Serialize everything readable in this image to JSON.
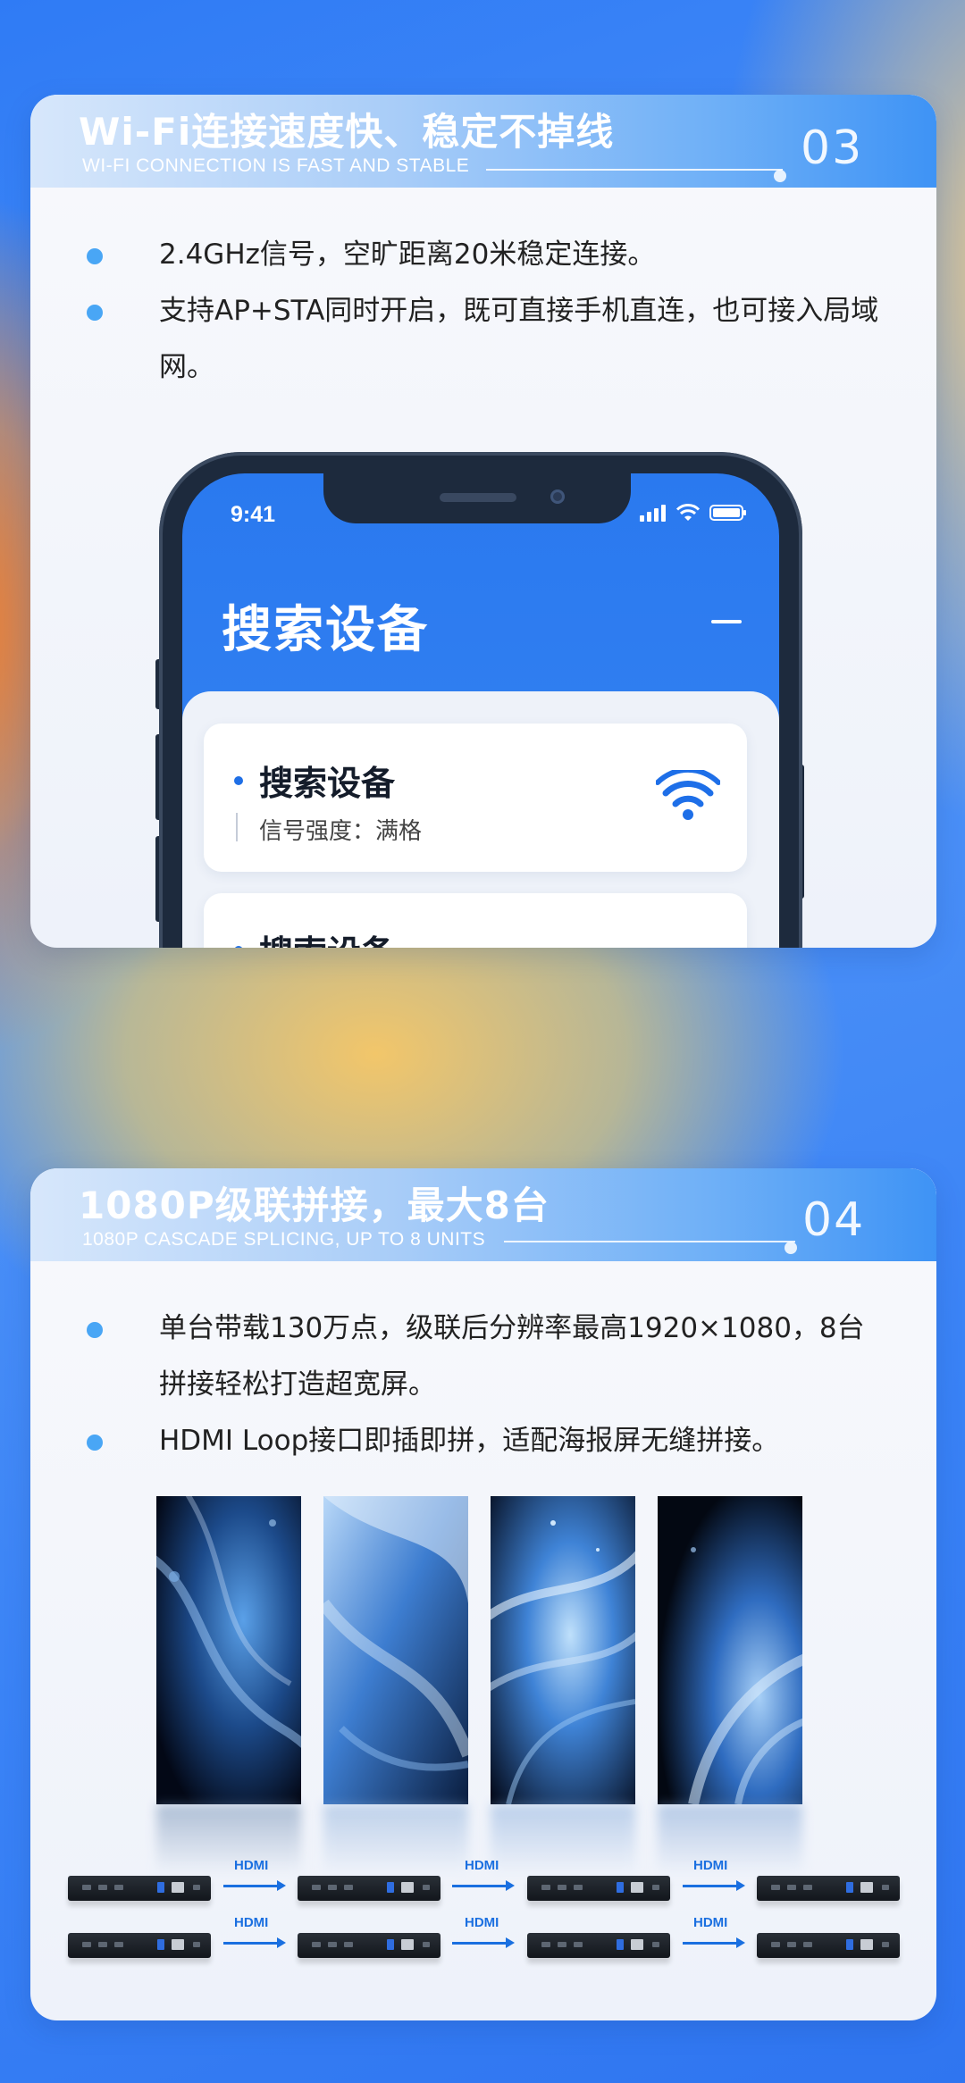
{
  "section1": {
    "title": "Wi-Fi连接速度快、稳定不掉线",
    "subtitle": "WI-FI CONNECTION IS FAST AND STABLE",
    "number": "03",
    "bullets": [
      "2.4GHz信号，空旷距离20米稳定连接。",
      "支持AP+STA同时开启，既可直接手机直连，也可接入局域网。"
    ],
    "phone": {
      "time": "9:41",
      "app_title": "搜索设备",
      "devices": [
        {
          "name": "搜索设备",
          "signal": "信号强度：满格"
        },
        {
          "name": "搜索设备"
        }
      ]
    }
  },
  "section2": {
    "title": "1080P级联拼接，最大8台",
    "subtitle": "1080P CASCADE SPLICING, UP TO 8 UNITS",
    "number": "04",
    "bullets": [
      "单台带载130万点，级联后分辨率最高1920×1080，8台拼接轻松打造超宽屏。",
      "HDMI Loop接口即插即拼，适配海报屏无缝拼接。"
    ],
    "connection_label": "HDMI"
  },
  "colors": {
    "accent": "#49a6f5",
    "phone_blue": "#2a79ef",
    "hdmi_blue": "#1a6fe0"
  }
}
